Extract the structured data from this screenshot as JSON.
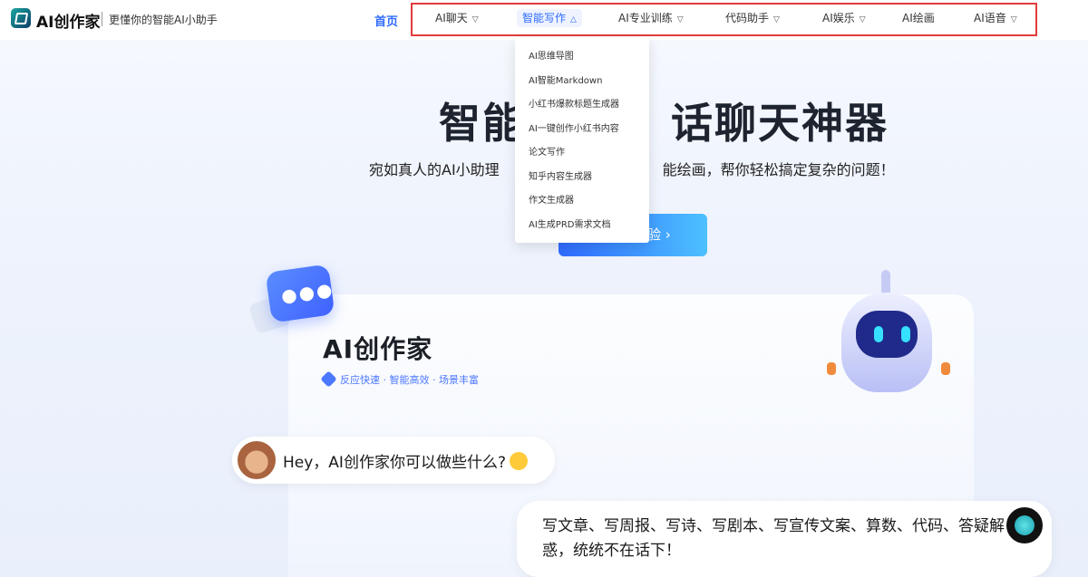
{
  "header": {
    "logo_text": "AI创作家",
    "slogan": "更懂你的智能AI小助手",
    "home_label": "首页",
    "nav": [
      {
        "label": "AI聊天",
        "active": false
      },
      {
        "label": "智能写作",
        "active": true
      },
      {
        "label": "AI专业训练",
        "active": false
      },
      {
        "label": "代码助手",
        "active": false
      },
      {
        "label": "AI娱乐",
        "active": false
      },
      {
        "label": "AI绘画",
        "active": false
      },
      {
        "label": "AI语音",
        "active": false
      }
    ]
  },
  "dropdown": {
    "items": [
      "AI思维导图",
      "AI智能Markdown",
      "小红书爆款标题生成器",
      "AI一键创作小红书内容",
      "论文写作",
      "知乎内容生成器",
      "作文生成器",
      "AI生成PRD需求文档"
    ]
  },
  "hero": {
    "title_left": "智能",
    "title_right": "话聊天神器",
    "subtitle_left": "宛如真人的AI小助理",
    "subtitle_right": "能绘画，帮你轻松搞定复杂的问题！",
    "cta_label": "验 ›"
  },
  "card": {
    "title": "AI创作家",
    "tagline": "反应快速 · 智能高效 · 场景丰富"
  },
  "chat": {
    "user_message": "Hey，AI创作家你可以做些什么?",
    "bot_message": "写文章、写周报、写诗、写剧本、写宣传文案、算数、代码、答疑解惑，统统不在话下！"
  },
  "colors": {
    "accent": "#2f6bff",
    "highlight_box": "#e33b3b"
  }
}
